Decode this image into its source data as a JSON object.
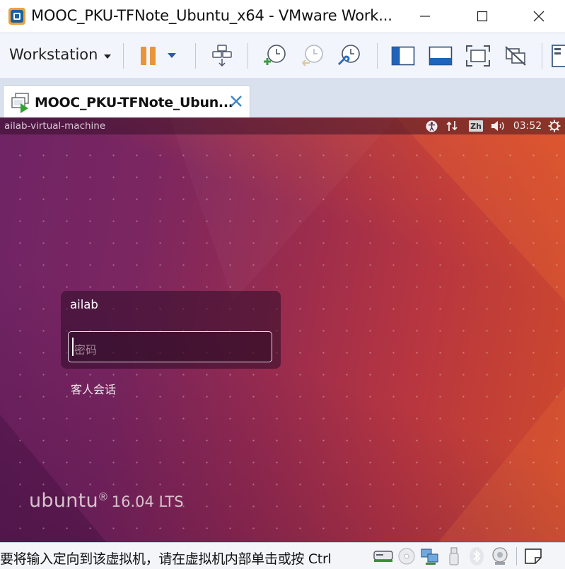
{
  "window": {
    "title": "MOOC_PKU-TFNote_Ubuntu_x64 - VMware Work...",
    "app_icon": "vmware-workstation-icon",
    "controls": [
      "minimize-icon",
      "maximize-icon",
      "close-icon"
    ]
  },
  "toolbar": {
    "workstation_menu_label": "Workstation",
    "buttons": [
      "pause-icon",
      "power-dropdown-icon",
      "send-ctrl-alt-del-icon",
      "take-snapshot-icon",
      "revert-snapshot-icon",
      "snapshot-manager-icon",
      "show-library-icon",
      "console-view-icon",
      "full-screen-icon",
      "unity-icon",
      "thumbnail-bar-icon"
    ],
    "accent_color": "#e8953a"
  },
  "tab": {
    "label": "MOOC_PKU-TFNote_Ubun...",
    "close_icon": "close-icon",
    "close_color": "#3c84c4"
  },
  "vm": {
    "hostname": "ailab-virtual-machine",
    "tray": {
      "accessibility_icon": "accessibility-icon",
      "network_icon": "network-updown-icon",
      "input_method": "Zh",
      "volume_icon": "volume-icon",
      "time": "03:52",
      "settings_icon": "power-gear-icon"
    },
    "login": {
      "username": "ailab",
      "password_placeholder": "密码",
      "guest_session": "客人会话"
    },
    "branding": {
      "word": "ubuntu",
      "registered": "®",
      "version": "16.04 LTS"
    },
    "background_colors": [
      "#6f2465",
      "#9a2c4e",
      "#cf4a2c"
    ]
  },
  "statusbar": {
    "text": "要将输入定向到该虚拟机，请在虚拟机内部单击或按 Ctrl",
    "devices": [
      "hard-disk-icon",
      "cd-dvd-icon",
      "network-adapter-icon",
      "usb-icon",
      "bluetooth-icon",
      "sound-card-icon",
      "message-log-icon"
    ]
  }
}
